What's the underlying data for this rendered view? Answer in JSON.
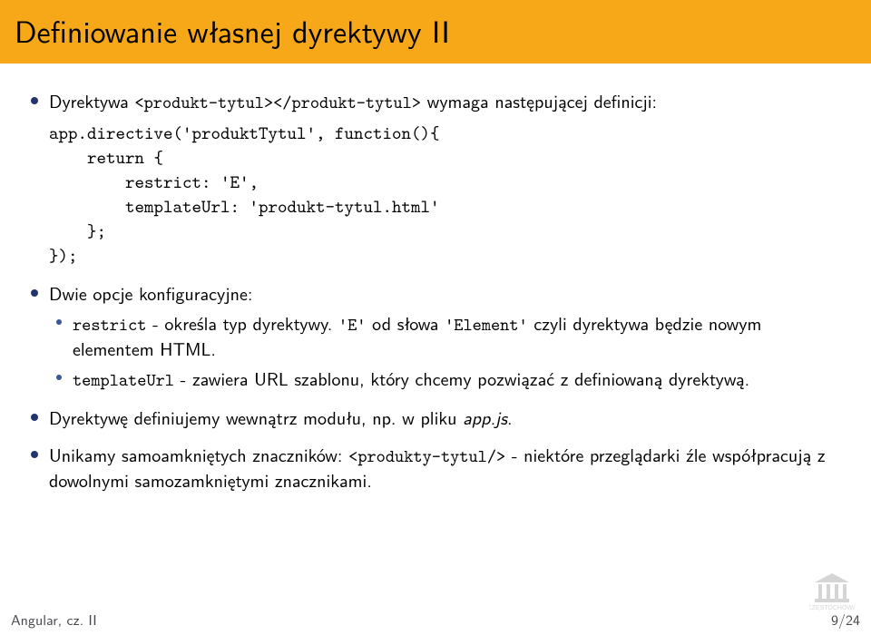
{
  "title": "Definiowanie własnej dyrektywy II",
  "bullet1_pre": "Dyrektywa ",
  "bullet1_code": "<produkt-tytul></produkt-tytul>",
  "bullet1_post": " wymaga następującej definicji:",
  "code": {
    "l1": "app.directive('produktTytul', function(){",
    "l2": "return {",
    "l3": "restrict: 'E',",
    "l4": "templateUrl: 'produkt-tytul.html'",
    "l5": "};",
    "l6": "});"
  },
  "bullet2": "Dwie opcje konfiguracyjne:",
  "inner1_code1": "restrict",
  "inner1_mid": " - określa typ dyrektywy. ",
  "inner1_code2": "'E'",
  "inner1_mid2": " od słowa ",
  "inner1_code3": "'Element'",
  "inner1_post": " czyli dyrektywa będzie nowym elementem HTML.",
  "inner2_code": "templateUrl",
  "inner2_post": " - zawiera URL szablonu, który chcemy pozwiązać z definiowaną dyrektywą.",
  "bullet3_pre": "Dyrektywę definiujemy wewnątrz modułu, np. w pliku ",
  "bullet3_file": "app.js",
  "bullet3_post": ".",
  "bullet4_pre": "Unikamy samoamkniętych znaczników: ",
  "bullet4_code": "<produkty-tytul/>",
  "bullet4_post": " - niektóre przeglądarki źle współpracują z dowolnymi samozamkniętymi znacznikami.",
  "footer_left": "Angular, cz. II",
  "footer_right": "9/24"
}
